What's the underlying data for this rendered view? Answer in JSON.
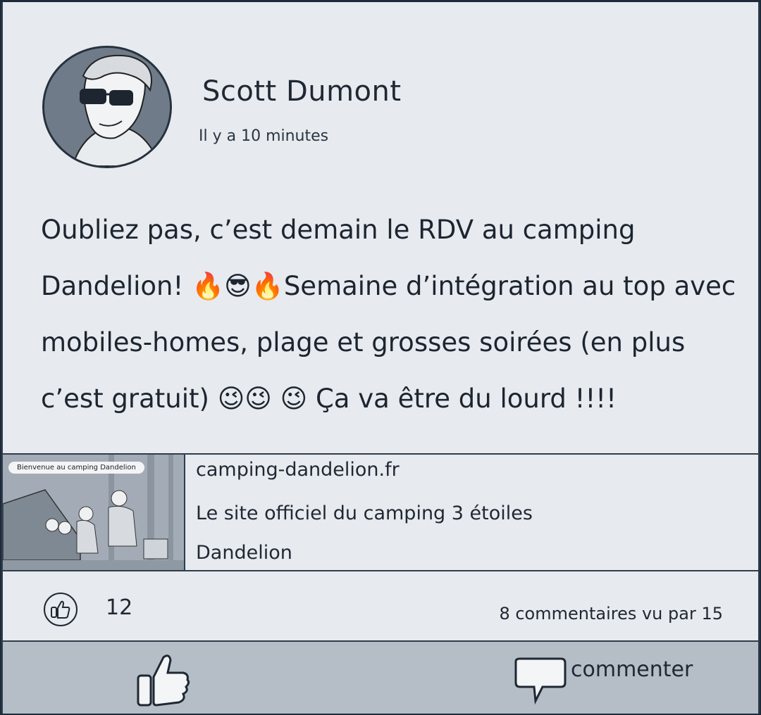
{
  "post": {
    "author": "Scott Dumont",
    "timestamp": "Il y a 10 minutes",
    "text": "Oubliez pas, c’est demain le RDV au camping\nDandelion! 🔥😎🔥Semaine d’intégration au top avec\nmobiles-homes, plage et grosses soirées (en plus\nc’est gratuit) 😉😉 😉 Ça va être du lourd !!!!"
  },
  "link_preview": {
    "image_caption": "Bienvenue au camping Dandelion",
    "domain": "camping-dandelion.fr",
    "description": "Le site officiel du camping 3 étoiles Dandelion"
  },
  "stats": {
    "likes": "12",
    "comments_and_views": "8 commentaires vu par 15"
  },
  "actions": {
    "comment_label": "commenter"
  },
  "icons": {
    "like_badge": "thumbs-up-icon",
    "like_button": "thumbs-up-icon",
    "comment_button": "speech-bubble-icon"
  },
  "colors": {
    "card_background": "#e7eaee",
    "action_bar": "#b5bdc6",
    "ink": "#1f2833"
  }
}
